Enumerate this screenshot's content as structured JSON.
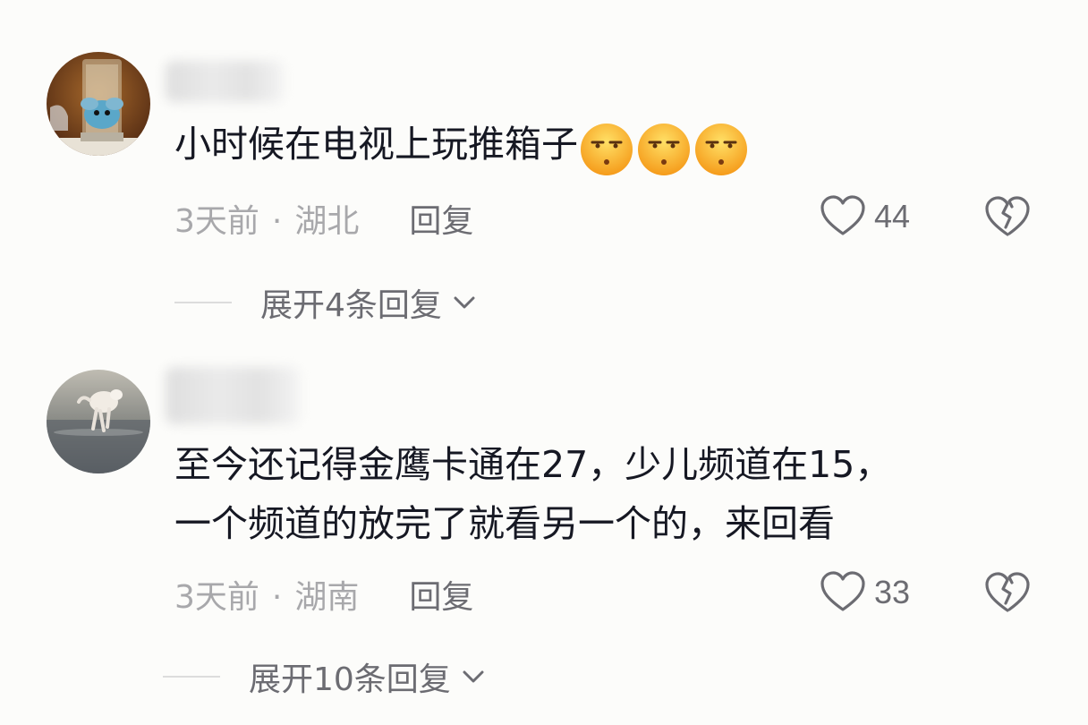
{
  "comments": [
    {
      "text": "小时候在电视上玩推箱子",
      "emojis": [
        "smirk-face-icon",
        "smirk-face-icon",
        "smirk-face-icon"
      ],
      "time": "3天前",
      "location": "湖北",
      "reply_label": "回复",
      "likes": "44",
      "expand_label": "展开4条回复"
    },
    {
      "text_line1": "至今还记得金鹰卡通在27，少儿频道在15，",
      "text_line2": "一个频道的放完了就看另一个的，来回看",
      "time": "3天前",
      "location": "湖南",
      "reply_label": "回复",
      "likes": "33",
      "expand_label": "展开10条回复"
    }
  ],
  "colors": {
    "primary_text": "#161823",
    "meta_text": "#a8a8ab",
    "secondary_text": "#6c6c72",
    "background": "#fcfcfa"
  }
}
